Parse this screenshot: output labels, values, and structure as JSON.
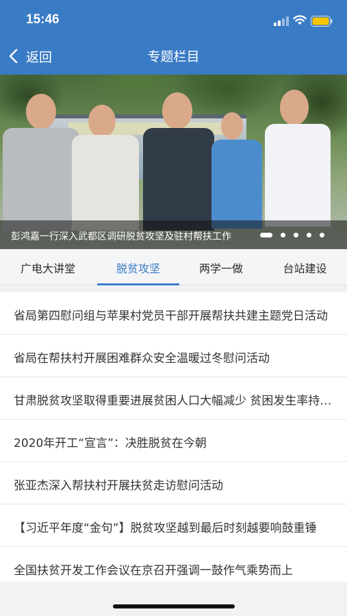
{
  "status_bar": {
    "time": "15:46"
  },
  "navbar": {
    "back_label": "返回",
    "title": "专题栏目"
  },
  "banner": {
    "caption": "彭鸿嘉一行深入武都区调研脱贫攻坚及驻村帮扶工作",
    "slide_count": 5,
    "active_slide": 1
  },
  "tabs": [
    {
      "label": "广电大讲堂",
      "active": false
    },
    {
      "label": "脱贫攻坚",
      "active": true
    },
    {
      "label": "两学一做",
      "active": false
    },
    {
      "label": "台站建设",
      "active": false
    }
  ],
  "articles": [
    "省局第四慰问组与苹果村党员干部开展帮扶共建主题党日活动",
    "省局在帮扶村开展困难群众安全温暖过冬慰问活动",
    "甘肃脱贫攻坚取得重要进展贫困人口大幅减少 贫困发生率持续下降",
    "2020年开工“宣言”：决胜脱贫在今朝",
    "张亚杰深入帮扶村开展扶贫走访慰问活动",
    "【习近平年度“金句”】脱贫攻坚越到最后时刻越要响鼓重锤",
    "全国扶贫开发工作会议在京召开强调一鼓作气乘势而上"
  ],
  "colors": {
    "accent": "#3a7bc5",
    "header_bg": "#3a7bc5"
  }
}
